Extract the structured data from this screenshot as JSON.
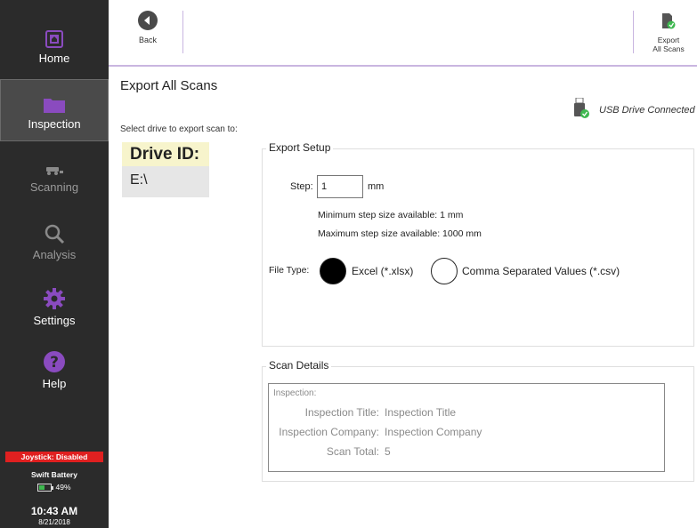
{
  "sidebar": {
    "items": [
      {
        "label": "Home",
        "icon": "home-icon"
      },
      {
        "label": "Inspection",
        "icon": "folder-icon"
      },
      {
        "label": "Scanning",
        "icon": "scanner-icon"
      },
      {
        "label": "Analysis",
        "icon": "magnifier-icon"
      },
      {
        "label": "Settings",
        "icon": "gear-icon"
      },
      {
        "label": "Help",
        "icon": "help-icon"
      }
    ],
    "joystick": "Joystick: Disabled",
    "battery_title": "Swift Battery",
    "battery_percent": "49%",
    "battery_level": 0.49,
    "time": "10:43 AM",
    "date": "8/21/2018"
  },
  "toolbar": {
    "back_label": "Back",
    "export_label_line1": "Export",
    "export_label_line2": "All Scans"
  },
  "main": {
    "title": "Export All Scans",
    "usb_status": "USB Drive Connected",
    "select_drive_label": "Select drive to export scan to:",
    "drive_header": "Drive ID:",
    "drives": [
      "E:\\"
    ]
  },
  "export_setup": {
    "title": "Export Setup",
    "step_label": "Step:",
    "step_value": "1",
    "step_unit": "mm",
    "min_step": "Minimum step size available: 1 mm",
    "max_step": "Maximum step size available: 1000 mm",
    "file_type_label": "File Type:",
    "options": [
      {
        "label": "Excel (*.xlsx)",
        "selected": true
      },
      {
        "label": "Comma Separated Values (*.csv)",
        "selected": false
      }
    ]
  },
  "scan_details": {
    "title": "Scan Details",
    "inner_title": "Inspection:",
    "rows": [
      {
        "key": "Inspection Title:",
        "value": "Inspection Title"
      },
      {
        "key": "Inspection Company:",
        "value": "Inspection Company"
      },
      {
        "key": "Scan Total:",
        "value": "5"
      }
    ]
  },
  "colors": {
    "sidebar_bg": "#2b2b2b",
    "accent": "#8a4bbf",
    "joystick_bg": "#e02020",
    "drive_header_bg": "#f7f4cc"
  }
}
